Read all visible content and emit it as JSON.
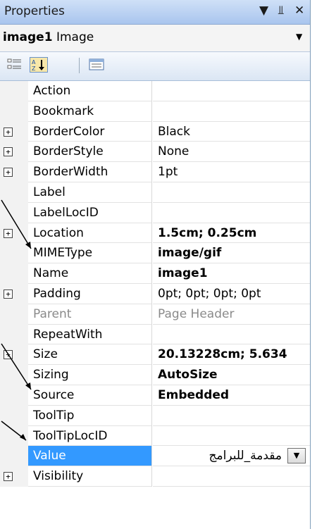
{
  "window": {
    "title": "Properties",
    "pin_icon": "pin-icon",
    "close_icon": "close-icon",
    "menu_icon": "menu-dropdown-icon"
  },
  "object_selector": {
    "name": "image1",
    "type": "Image"
  },
  "toolbar": {
    "categorized_icon": "categorized-icon",
    "alphabetical_icon": "alphabetical-icon",
    "pages_icon": "property-pages-icon"
  },
  "properties": [
    {
      "name": "Action",
      "value": "",
      "expandable": false,
      "bold": false
    },
    {
      "name": "Bookmark",
      "value": "",
      "expandable": false,
      "bold": false
    },
    {
      "name": "BorderColor",
      "value": "Black",
      "expandable": true,
      "bold": false
    },
    {
      "name": "BorderStyle",
      "value": "None",
      "expandable": true,
      "bold": false
    },
    {
      "name": "BorderWidth",
      "value": "1pt",
      "expandable": true,
      "bold": false
    },
    {
      "name": "Label",
      "value": "",
      "expandable": false,
      "bold": false
    },
    {
      "name": "LabelLocID",
      "value": "",
      "expandable": false,
      "bold": false
    },
    {
      "name": "Location",
      "value": "1.5cm; 0.25cm",
      "expandable": true,
      "bold": true
    },
    {
      "name": "MIMEType",
      "value": "image/gif",
      "expandable": false,
      "bold": true
    },
    {
      "name": "Name",
      "value": "image1",
      "expandable": false,
      "bold": true
    },
    {
      "name": "Padding",
      "value": "0pt; 0pt; 0pt; 0pt",
      "expandable": true,
      "bold": false
    },
    {
      "name": "Parent",
      "value": "Page Header",
      "expandable": false,
      "bold": false,
      "disabled": true
    },
    {
      "name": "RepeatWith",
      "value": "",
      "expandable": false,
      "bold": false
    },
    {
      "name": "Size",
      "value": "20.13228cm; 5.634",
      "expandable": true,
      "bold": true
    },
    {
      "name": "Sizing",
      "value": "AutoSize",
      "expandable": false,
      "bold": true
    },
    {
      "name": "Source",
      "value": "Embedded",
      "expandable": false,
      "bold": true
    },
    {
      "name": "ToolTip",
      "value": "",
      "expandable": false,
      "bold": false
    },
    {
      "name": "ToolTipLocID",
      "value": "",
      "expandable": false,
      "bold": false
    },
    {
      "name": "Value",
      "value": "مقدمة_للبرامج",
      "expandable": false,
      "bold": false,
      "selected": true
    },
    {
      "name": "Visibility",
      "value": "",
      "expandable": true,
      "bold": false
    }
  ],
  "colors": {
    "selection": "#3399ff",
    "arrow": "#000000"
  }
}
